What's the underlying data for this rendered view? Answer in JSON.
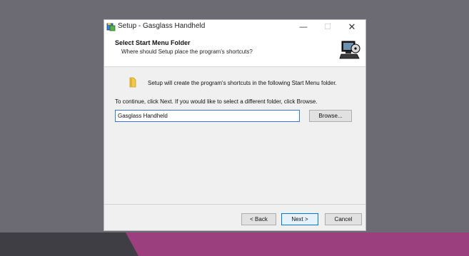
{
  "window": {
    "title": "Setup - Gasglass Handheld",
    "controls": {
      "minimize": "—",
      "maximize": "☐",
      "close": "✕"
    }
  },
  "header": {
    "title": "Select Start Menu Folder",
    "subtitle": "Where should Setup place the program's shortcuts?"
  },
  "body": {
    "info": "Setup will create the program's shortcuts in the following Start Menu folder.",
    "instructions": "To continue, click Next. If you would like to select a different folder, click Browse.",
    "folder_value": "Gasglass Handheld",
    "browse_label": "Browse..."
  },
  "footer": {
    "back_label": "< Back",
    "next_label": "Next >",
    "cancel_label": "Cancel"
  },
  "icons": {
    "app": "setup-app-icon",
    "header": "computer-install-icon",
    "folder": "folder-icon"
  },
  "colors": {
    "desktop": "#6c6b73",
    "band": "#9b3f7f",
    "focus": "#2f7ad6",
    "default_button": "#0078d7"
  }
}
